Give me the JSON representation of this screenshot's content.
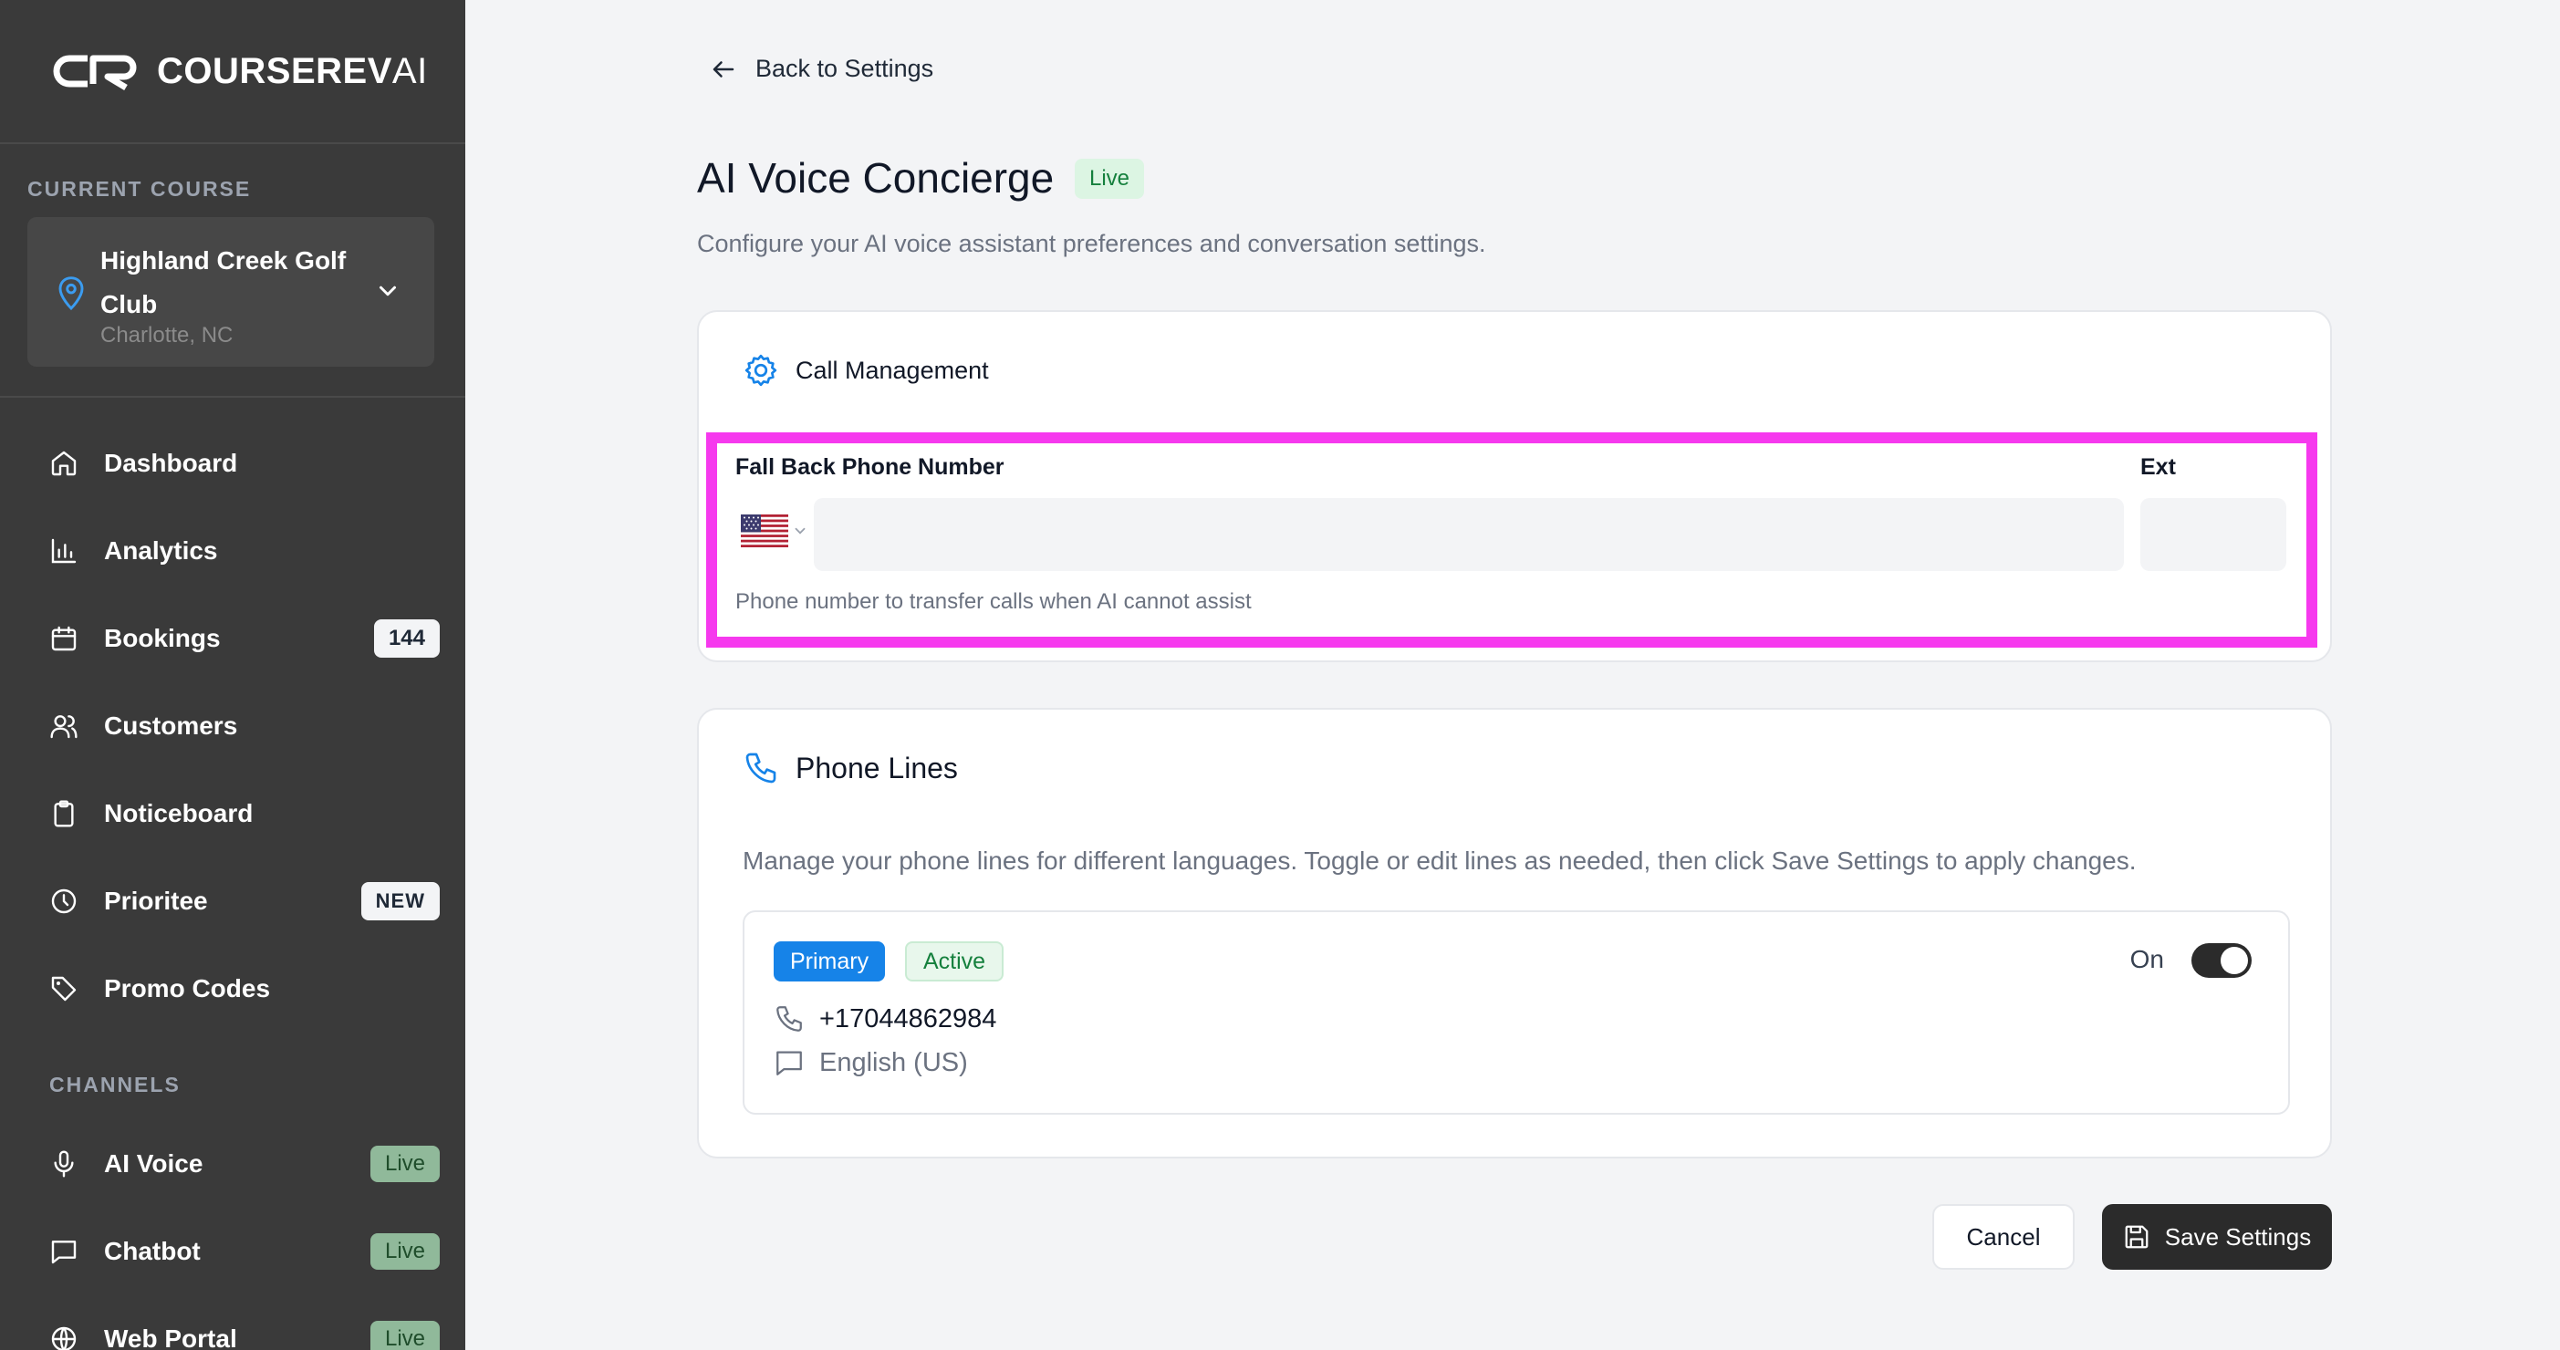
{
  "brand": {
    "name_bold": "COURSEREV",
    "name_light": "AI"
  },
  "sidebar": {
    "current_course_label": "CURRENT COURSE",
    "course": {
      "name": "Highland Creek Golf Club",
      "location": "Charlotte, NC"
    },
    "nav": [
      {
        "label": "Dashboard",
        "icon": "home-icon"
      },
      {
        "label": "Analytics",
        "icon": "bar-chart-icon"
      },
      {
        "label": "Bookings",
        "icon": "calendar-icon",
        "badge": "144"
      },
      {
        "label": "Customers",
        "icon": "users-icon"
      },
      {
        "label": "Noticeboard",
        "icon": "clipboard-icon"
      },
      {
        "label": "Prioritee",
        "icon": "clock-icon",
        "badge": "NEW"
      },
      {
        "label": "Promo Codes",
        "icon": "tag-icon"
      }
    ],
    "channels_label": "CHANNELS",
    "channels": [
      {
        "label": "AI Voice",
        "icon": "mic-icon",
        "badge": "Live"
      },
      {
        "label": "Chatbot",
        "icon": "chat-icon",
        "badge": "Live"
      },
      {
        "label": "Web Portal",
        "icon": "globe-icon",
        "badge": "Live"
      }
    ]
  },
  "header": {
    "back_label": "Back to Settings",
    "title": "AI Voice Concierge",
    "status_badge": "Live",
    "subtitle": "Configure your AI voice assistant preferences and conversation settings."
  },
  "call_management": {
    "title": "Call Management",
    "fallback_label": "Fall Back Phone Number",
    "ext_label": "Ext",
    "phone_value": "",
    "ext_value": "",
    "help": "Phone number to transfer calls when AI cannot assist",
    "country": "US"
  },
  "phone_lines": {
    "title": "Phone Lines",
    "description": "Manage your phone lines for different languages. Toggle or edit lines as needed, then click Save Settings to apply changes.",
    "lines": [
      {
        "primary_badge": "Primary",
        "status_badge": "Active",
        "toggle_label": "On",
        "toggle_on": true,
        "number": "+17044862984",
        "language": "English (US)"
      }
    ]
  },
  "actions": {
    "cancel": "Cancel",
    "save": "Save Settings"
  },
  "colors": {
    "accent": "#1683e8",
    "sidebar": "#3a3a3a",
    "highlight": "#f639ee",
    "live_green": "#15803d"
  }
}
